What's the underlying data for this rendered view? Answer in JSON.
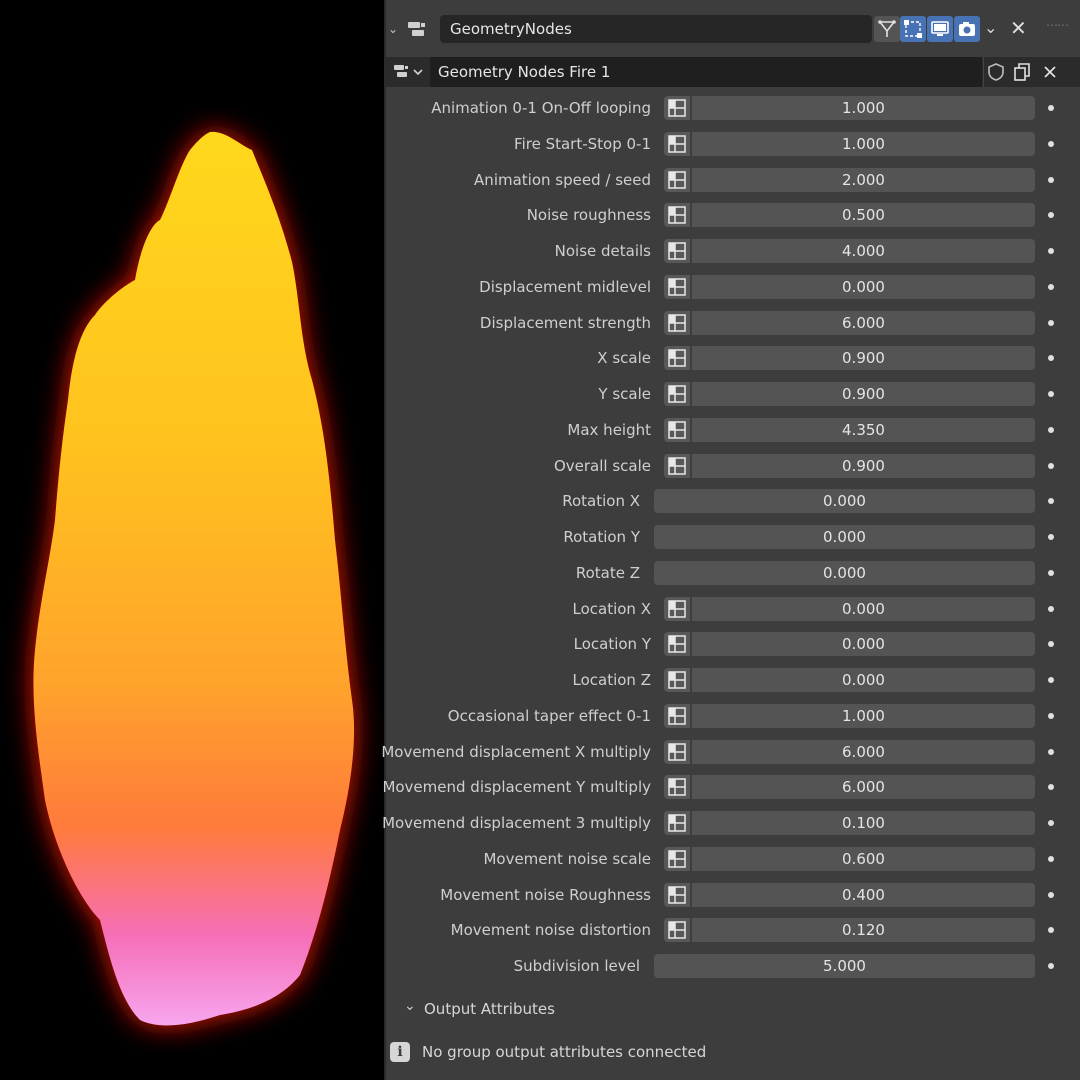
{
  "modifier": {
    "name": "GeometryNodes",
    "buttons": [
      {
        "icon": "edit-mode-icon",
        "active": false
      },
      {
        "icon": "cage-icon",
        "active": true
      },
      {
        "icon": "viewport-display-icon",
        "active": true
      },
      {
        "icon": "render-camera-icon",
        "active": true
      }
    ]
  },
  "node_group": {
    "name": "Geometry Nodes Fire 1"
  },
  "parameters": [
    {
      "label": "Animation 0-1 On-Off looping",
      "value": "1.000",
      "attribute_toggle": true
    },
    {
      "label": "Fire Start-Stop 0-1",
      "value": "1.000",
      "attribute_toggle": true
    },
    {
      "label": "Animation speed / seed",
      "value": "2.000",
      "attribute_toggle": true
    },
    {
      "label": "Noise roughness",
      "value": "0.500",
      "attribute_toggle": true
    },
    {
      "label": "Noise details",
      "value": "4.000",
      "attribute_toggle": true
    },
    {
      "label": "Displacement midlevel",
      "value": "0.000",
      "attribute_toggle": true
    },
    {
      "label": "Displacement strength",
      "value": "6.000",
      "attribute_toggle": true
    },
    {
      "label": "X scale",
      "value": "0.900",
      "attribute_toggle": true
    },
    {
      "label": "Y scale",
      "value": "0.900",
      "attribute_toggle": true
    },
    {
      "label": "Max height",
      "value": "4.350",
      "attribute_toggle": true
    },
    {
      "label": "Overall scale",
      "value": "0.900",
      "attribute_toggle": true
    },
    {
      "label": "Rotation X",
      "value": "0.000",
      "attribute_toggle": false
    },
    {
      "label": "Rotation Y",
      "value": "0.000",
      "attribute_toggle": false
    },
    {
      "label": "Rotate Z",
      "value": "0.000",
      "attribute_toggle": false
    },
    {
      "label": "Location X",
      "value": "0.000",
      "attribute_toggle": true
    },
    {
      "label": "Location Y",
      "value": "0.000",
      "attribute_toggle": true
    },
    {
      "label": "Location Z",
      "value": "0.000",
      "attribute_toggle": true
    },
    {
      "label": "Occasional taper effect 0-1",
      "value": "1.000",
      "attribute_toggle": true
    },
    {
      "label": "Movemend displacement X multiply",
      "value": "6.000",
      "attribute_toggle": true
    },
    {
      "label": "Movemend displacement Y multiply",
      "value": "6.000",
      "attribute_toggle": true
    },
    {
      "label": "Movemend displacement 3 multiply",
      "value": "0.100",
      "attribute_toggle": true
    },
    {
      "label": "Movement noise scale",
      "value": "0.600",
      "attribute_toggle": true
    },
    {
      "label": "Movement noise Roughness",
      "value": "0.400",
      "attribute_toggle": true
    },
    {
      "label": "Movement noise distortion",
      "value": "0.120",
      "attribute_toggle": true
    },
    {
      "label": "Subdivision level",
      "value": "5.000",
      "attribute_toggle": false
    }
  ],
  "output_attributes": {
    "label": "Output Attributes",
    "message": "No group output attributes connected"
  },
  "colors": {
    "panel_bg": "#3d3d3d",
    "field_bg": "#545454",
    "active_blue": "#4772b3",
    "flame_top": "#ffd21a",
    "flame_mid": "#ff9a2a",
    "flame_bottom": "#f27ad6",
    "glow": "#ff1a00"
  }
}
